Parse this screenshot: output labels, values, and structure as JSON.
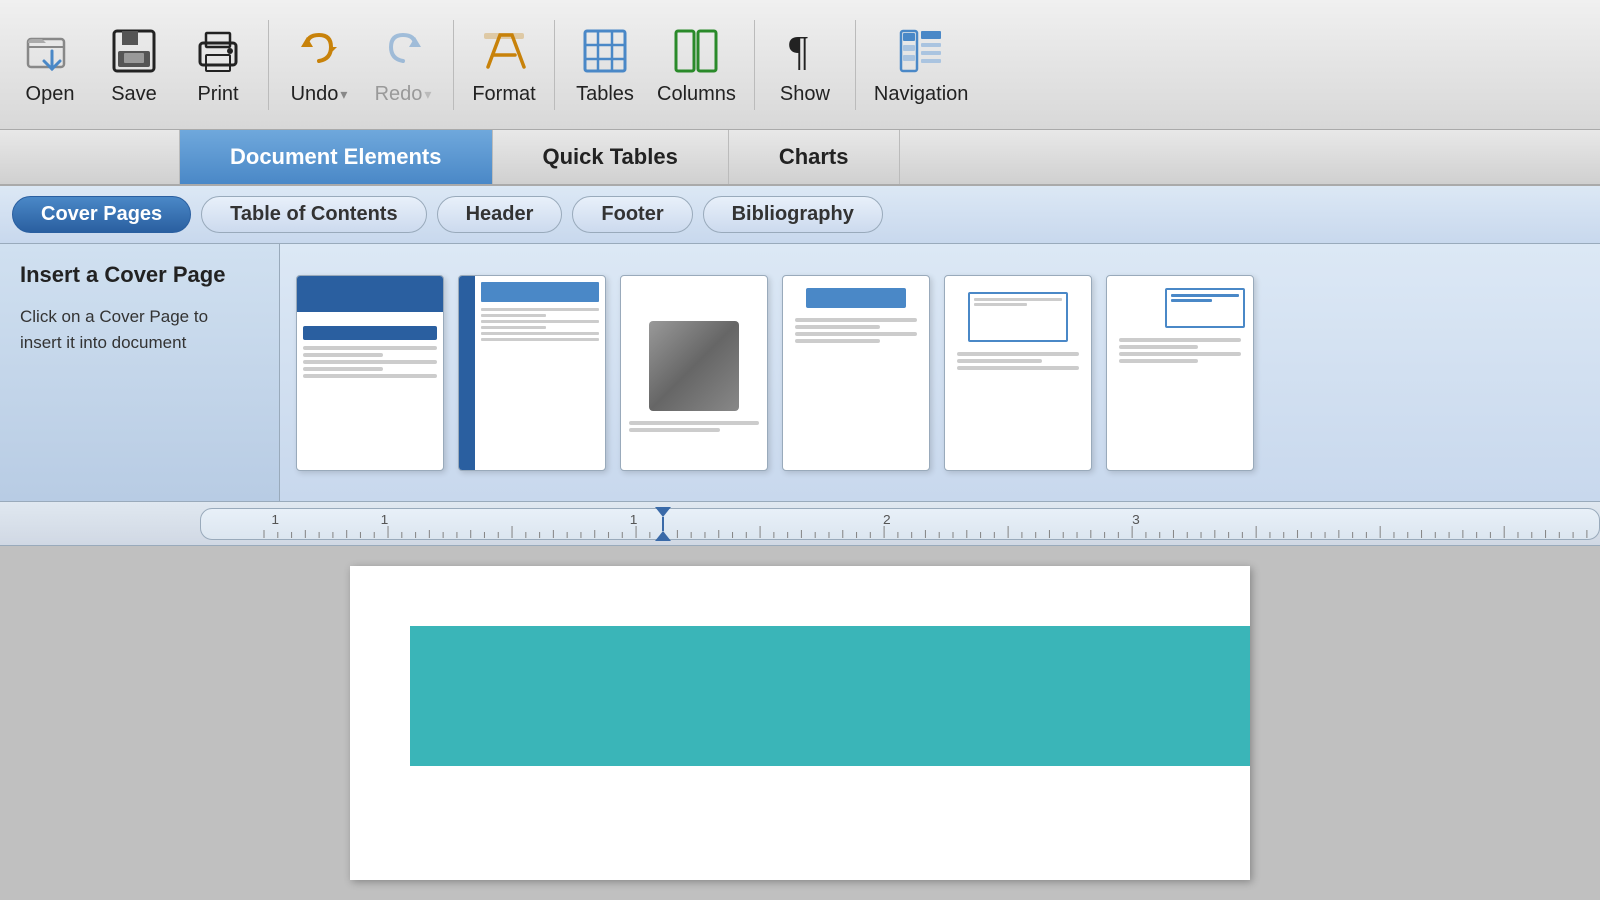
{
  "toolbar": {
    "items": [
      {
        "id": "open",
        "label": "Open",
        "icon": "open-icon"
      },
      {
        "id": "save",
        "label": "Save",
        "icon": "save-icon"
      },
      {
        "id": "print",
        "label": "Print",
        "icon": "print-icon"
      },
      {
        "id": "undo",
        "label": "Undo",
        "icon": "undo-icon"
      },
      {
        "id": "redo",
        "label": "Redo",
        "icon": "redo-icon",
        "disabled": true
      },
      {
        "id": "format",
        "label": "Format",
        "icon": "format-icon"
      },
      {
        "id": "tables",
        "label": "Tables",
        "icon": "tables-icon"
      },
      {
        "id": "columns",
        "label": "Columns",
        "icon": "columns-icon"
      },
      {
        "id": "show",
        "label": "Show",
        "icon": "show-icon"
      },
      {
        "id": "navigation",
        "label": "Navigation",
        "icon": "navigation-icon"
      }
    ]
  },
  "ribbon": {
    "tabs": [
      {
        "id": "document-elements",
        "label": "Document Elements",
        "active": true
      },
      {
        "id": "quick-tables",
        "label": "Quick Tables",
        "active": false
      },
      {
        "id": "charts",
        "label": "Charts",
        "active": false
      }
    ]
  },
  "sub_tabs": [
    {
      "id": "cover-pages",
      "label": "Cover Pages",
      "active": true
    },
    {
      "id": "table-of-contents",
      "label": "Table of Contents",
      "active": false
    },
    {
      "id": "header",
      "label": "Header",
      "active": false
    },
    {
      "id": "footer",
      "label": "Footer",
      "active": false
    },
    {
      "id": "bibliography",
      "label": "Bibliography",
      "active": false
    }
  ],
  "cover_section": {
    "title": "Insert a Cover Page",
    "description_line1": "Click on a Cover Page to",
    "description_line2": "insert it into document",
    "thumbnails": [
      {
        "id": "thumb1",
        "style": "blue-header"
      },
      {
        "id": "thumb2",
        "style": "sidebar"
      },
      {
        "id": "thumb3",
        "style": "image"
      },
      {
        "id": "thumb4",
        "style": "blue-box-top"
      },
      {
        "id": "thumb5",
        "style": "bordered-box"
      },
      {
        "id": "thumb6",
        "style": "right-box"
      }
    ]
  },
  "ruler": {
    "marker_position": "33%",
    "numbers": [
      "1",
      "1",
      "2",
      "3"
    ]
  },
  "document": {
    "teal_bar_color": "#3ab5b8"
  }
}
